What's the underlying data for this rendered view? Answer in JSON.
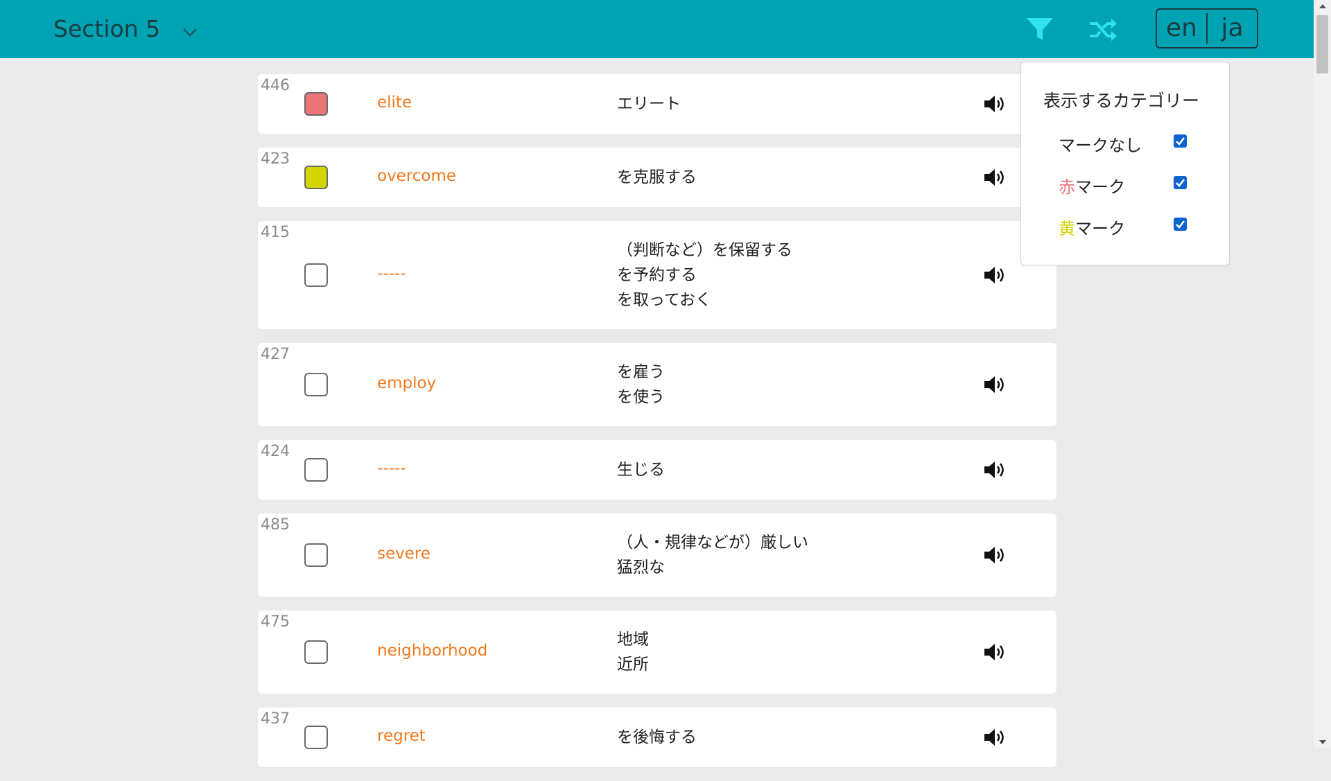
{
  "header": {
    "section_title": "Section 5",
    "lang_en": "en",
    "lang_ja": "ja",
    "brand_color": "#00a3b4"
  },
  "filter_popover": {
    "title": "表示するカテゴリー",
    "options": [
      {
        "prefix": "",
        "label": "マークなし",
        "checked": true,
        "prefix_color": "#222222"
      },
      {
        "prefix": "赤",
        "label": "マーク",
        "checked": true,
        "prefix_color": "#e87878"
      },
      {
        "prefix": "黄",
        "label": "マーク",
        "checked": true,
        "prefix_color": "#d2d200"
      }
    ]
  },
  "mark_colors": {
    "red": "#ec7676",
    "yellow": "#d4d400",
    "none": "#ffffff"
  },
  "word_color": "#f07a1d",
  "words": [
    {
      "num": "446",
      "mark": "red",
      "word": "elite",
      "meanings": [
        "エリート"
      ]
    },
    {
      "num": "423",
      "mark": "yellow",
      "word": "overcome",
      "meanings": [
        "を克服する"
      ]
    },
    {
      "num": "415",
      "mark": "none",
      "word": "-----",
      "meanings": [
        "（判断など）を保留する",
        "を予約する",
        "を取っておく"
      ]
    },
    {
      "num": "427",
      "mark": "none",
      "word": "employ",
      "meanings": [
        "を雇う",
        "を使う"
      ]
    },
    {
      "num": "424",
      "mark": "none",
      "word": "-----",
      "meanings": [
        "生じる"
      ]
    },
    {
      "num": "485",
      "mark": "none",
      "word": "severe",
      "meanings": [
        "（人・規律などが）厳しい",
        "猛烈な"
      ]
    },
    {
      "num": "475",
      "mark": "none",
      "word": "neighborhood",
      "meanings": [
        "地域",
        "近所"
      ]
    },
    {
      "num": "437",
      "mark": "none",
      "word": "regret",
      "meanings": [
        "を後悔する"
      ]
    }
  ]
}
